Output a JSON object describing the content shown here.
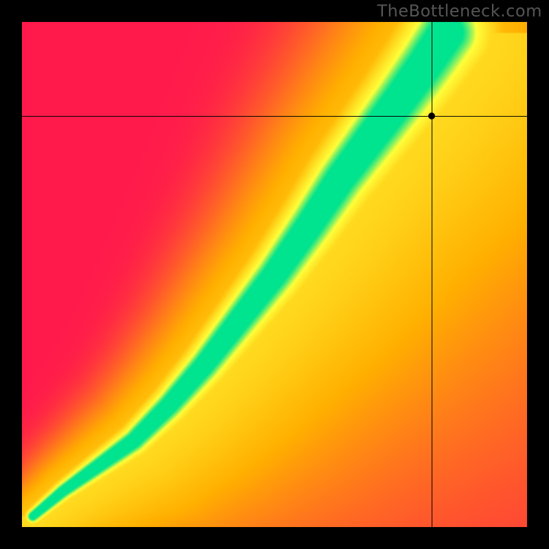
{
  "watermark": "TheBottleneck.com",
  "chart_data": {
    "type": "heatmap",
    "title": "",
    "xlabel": "",
    "ylabel": "",
    "xlim": [
      0,
      1
    ],
    "ylim": [
      0,
      1
    ],
    "axes_visible": false,
    "crosshair": {
      "x": 0.8105,
      "y": 0.8135
    },
    "ridge": {
      "comment": "approximate path of the green ideal-match band (x,y pairs, normalized)",
      "points": [
        [
          0.02,
          0.02
        ],
        [
          0.08,
          0.07
        ],
        [
          0.15,
          0.12
        ],
        [
          0.22,
          0.17
        ],
        [
          0.29,
          0.24
        ],
        [
          0.36,
          0.32
        ],
        [
          0.43,
          0.41
        ],
        [
          0.5,
          0.5
        ],
        [
          0.57,
          0.6
        ],
        [
          0.63,
          0.69
        ],
        [
          0.69,
          0.77
        ],
        [
          0.75,
          0.85
        ],
        [
          0.8,
          0.92
        ],
        [
          0.84,
          0.98
        ]
      ]
    },
    "ridge2": {
      "comment": "secondary faint yellow band toward top-right",
      "points": [
        [
          0.68,
          0.68
        ],
        [
          0.75,
          0.73
        ],
        [
          0.82,
          0.79
        ],
        [
          0.89,
          0.86
        ],
        [
          0.97,
          0.94
        ]
      ],
      "weight": 0.35
    },
    "colors": {
      "low": "#ff1a4b",
      "mid": "#ffb000",
      "hi": "#ffff3a",
      "peak": "#00e38f"
    }
  }
}
